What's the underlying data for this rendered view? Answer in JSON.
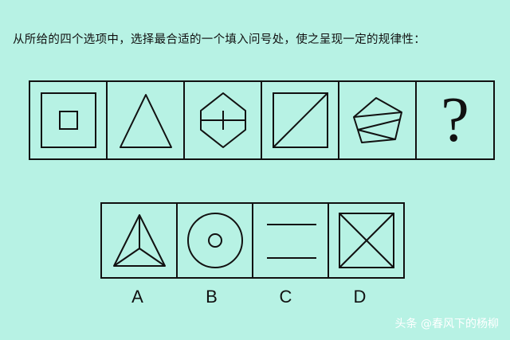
{
  "question": {
    "text": "从所给的四个选项中，选择最合适的一个填入问号处，使之呈现一定的规律性："
  },
  "top_row": {
    "figures": [
      "square-in-square-icon",
      "triangle-icon",
      "hexagon-split-icon",
      "square-diagonal-icon",
      "pentagon-split-icon"
    ],
    "question_mark": "?"
  },
  "options": [
    {
      "label": "A",
      "figure": "triangle-center-lines-icon"
    },
    {
      "label": "B",
      "figure": "concentric-circles-icon"
    },
    {
      "label": "C",
      "figure": "two-parallel-lines-icon"
    },
    {
      "label": "D",
      "figure": "square-cross-icon"
    }
  ],
  "watermark": {
    "text": "头条 @春风下的杨柳"
  }
}
